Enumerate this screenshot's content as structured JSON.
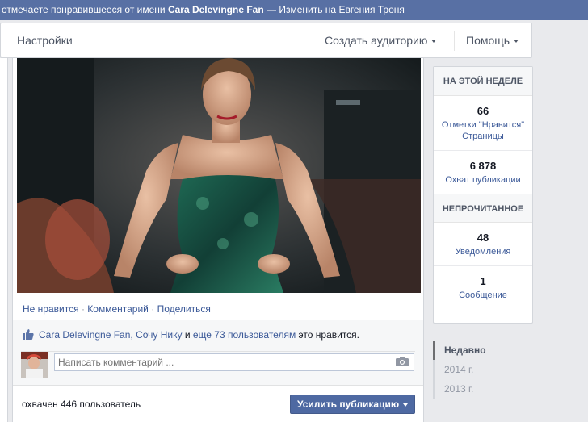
{
  "notice": {
    "prefix": "отмечаете понравившееся от имени ",
    "page_name": "Cara Delevingne Fan",
    "separator": " — ",
    "switch_link": "Изменить на Евгения Троня"
  },
  "tabs": {
    "settings": "Настройки",
    "create_audience": "Создать аудиторию",
    "help": "Помощь"
  },
  "post": {
    "actions": {
      "unlike": "Не нравится",
      "comment": "Комментарий",
      "share": "Поделиться",
      "dot": "·"
    },
    "likes": {
      "names": "Cara Delevingne Fan, Сочу Нику",
      "and_more": " и ",
      "others_link": "еще 73 пользователям",
      "suffix": " это нравится."
    },
    "comment_placeholder": "Написать комментарий ...",
    "reach": "охвачен 446 пользователь",
    "boost_label": "Усилить публикацию"
  },
  "sidebar": {
    "week_header": "НА ЭТОЙ НЕДЕЛЕ",
    "page_likes": {
      "value": "66",
      "label": "Отметки \"Нравится\" Страницы"
    },
    "post_reach": {
      "value": "6 878",
      "label": "Охват публикации"
    },
    "unread_header": "НЕПРОЧИТАННОЕ",
    "notifications": {
      "value": "48",
      "label": "Уведомления"
    },
    "messages": {
      "value": "1",
      "label": "Сообщение"
    }
  },
  "timeline": {
    "recent": "Недавно",
    "y2014": "2014 г.",
    "y2013": "2013 г."
  },
  "colors": {
    "topbar": "#5870a4",
    "link": "#3b5998",
    "boost_button": "#4e69a2"
  }
}
